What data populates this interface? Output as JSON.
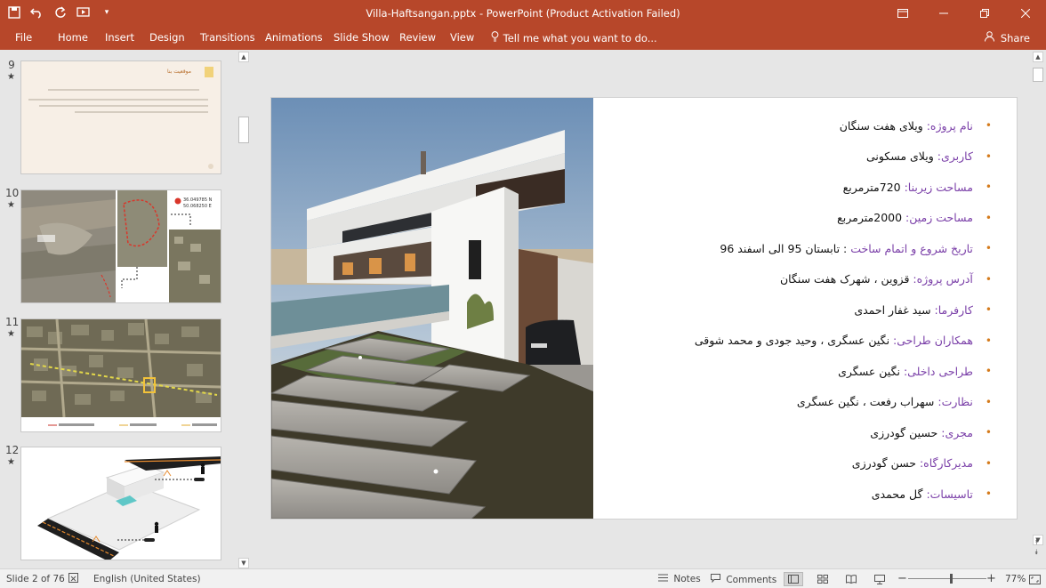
{
  "app": {
    "window_title": "Villa-Haftsangan.pptx - PowerPoint (Product Activation Failed)",
    "qat_icons": [
      "save-icon",
      "undo-icon",
      "redo-icon",
      "start-from-beginning-icon",
      "customize-qat-icon"
    ],
    "window_controls": [
      "ribbon-display-options-icon",
      "minimize-icon",
      "restore-icon",
      "close-icon"
    ]
  },
  "ribbon": {
    "tabs": [
      "File",
      "Home",
      "Insert",
      "Design",
      "Transitions",
      "Animations",
      "Slide Show",
      "Review",
      "View"
    ],
    "tellme": "Tell me what you want to do...",
    "share": "Share"
  },
  "thumbnails": [
    {
      "num": "9",
      "star": "★"
    },
    {
      "num": "10",
      "star": "★"
    },
    {
      "num": "11",
      "star": "★"
    },
    {
      "num": "12",
      "star": "★"
    }
  ],
  "thumb_texts": {
    "slide9_title": "موقعیت بنا",
    "slide10_coord1": "36.049785 N",
    "slide10_coord2": "50.068250 E"
  },
  "slide": {
    "bullets": [
      {
        "key": "نام پروژه:",
        "value": " ویلای هفت سنگان"
      },
      {
        "key": "کاربری:",
        "value": " ویلای مسکونی"
      },
      {
        "key": "مساحت زیربنا:",
        "value": " 720مترمربع"
      },
      {
        "key": "مساحت زمین:",
        "value": " 2000مترمربع"
      },
      {
        "key": "تاریخ شروع و اتمام ساخت",
        "value": " : تابستان 95 الی اسفند 96"
      },
      {
        "key": "آدرس پروژه:",
        "value": " قزوین ، شهرک هفت سنگان"
      },
      {
        "key": "کارفرما:",
        "value": " سید غفار احمدی"
      },
      {
        "key": "همکاران طراحی:",
        "value": " نگین عسگری ، وحید جودی و محمد شوقی"
      },
      {
        "key": "طراحی داخلی:",
        "value": " نگین عسگری"
      },
      {
        "key": "نظارت:",
        "value": " سهراب رفعت ، نگین عسگری"
      },
      {
        "key": "مجری:",
        "value": " حسین گودرزی"
      },
      {
        "key": "مدیرکارگاه:",
        "value": " حسن گودرزی"
      },
      {
        "key": "تاسیسات:",
        "value": " گل محمدی"
      }
    ],
    "bullet_char": "•"
  },
  "status": {
    "slide_info": "Slide 2 of 76",
    "language": "English (United States)",
    "notes": "Notes",
    "comments": "Comments",
    "zoom": "77%",
    "zoom_fraction": 0.55
  },
  "colors": {
    "accent": "#b7472a",
    "bullet_key": "#7a3fa8",
    "bullet_dot": "#d57b1c"
  }
}
